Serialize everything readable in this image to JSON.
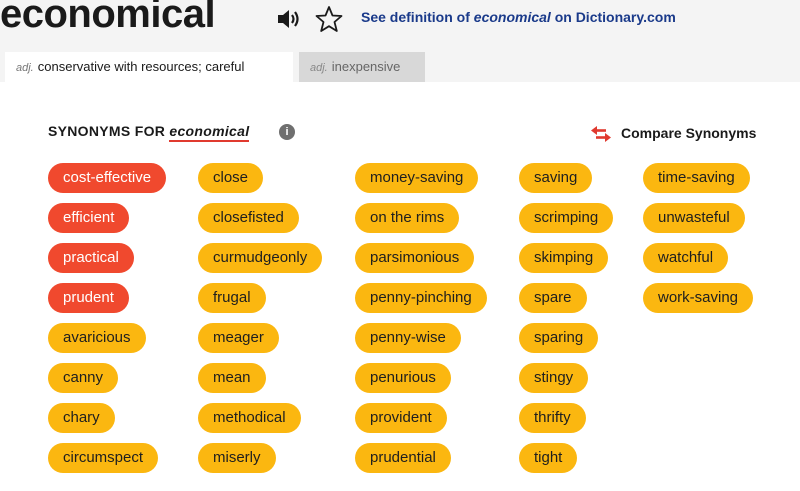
{
  "header": {
    "word": "economical",
    "dictionary_link": {
      "prefix": "See definition of ",
      "word": "economical",
      "suffix": " on Dictionary.com"
    }
  },
  "tabs": [
    {
      "pos": "adj.",
      "label": "conservative with resources; careful",
      "active": true
    },
    {
      "pos": "adj.",
      "label": "inexpensive",
      "active": false
    }
  ],
  "synonyms_section": {
    "heading_prefix": "SYNONYMS FOR ",
    "heading_word": "economical",
    "info_glyph": "i",
    "compare_label": "Compare Synonyms"
  },
  "colors": {
    "strong_match": "#f0492e",
    "match": "#fbb710",
    "heading_underline": "#e03a2f",
    "link": "#1a3a8a"
  },
  "icons": [
    "speaker-icon",
    "star-icon",
    "info-icon",
    "compare-arrows-icon"
  ],
  "synonym_columns": [
    [
      {
        "word": "cost-effective",
        "strength": "strong"
      },
      {
        "word": "efficient",
        "strength": "strong"
      },
      {
        "word": "practical",
        "strength": "strong"
      },
      {
        "word": "prudent",
        "strength": "strong"
      },
      {
        "word": "avaricious",
        "strength": "normal"
      },
      {
        "word": "canny",
        "strength": "normal"
      },
      {
        "word": "chary",
        "strength": "normal"
      },
      {
        "word": "circumspect",
        "strength": "normal"
      }
    ],
    [
      {
        "word": "close",
        "strength": "normal"
      },
      {
        "word": "closefisted",
        "strength": "normal"
      },
      {
        "word": "curmudgeonly",
        "strength": "normal"
      },
      {
        "word": "frugal",
        "strength": "normal"
      },
      {
        "word": "meager",
        "strength": "normal"
      },
      {
        "word": "mean",
        "strength": "normal"
      },
      {
        "word": "methodical",
        "strength": "normal"
      },
      {
        "word": "miserly",
        "strength": "normal"
      }
    ],
    [
      {
        "word": "money-saving",
        "strength": "normal"
      },
      {
        "word": "on the rims",
        "strength": "normal"
      },
      {
        "word": "parsimonious",
        "strength": "normal"
      },
      {
        "word": "penny-pinching",
        "strength": "normal"
      },
      {
        "word": "penny-wise",
        "strength": "normal"
      },
      {
        "word": "penurious",
        "strength": "normal"
      },
      {
        "word": "provident",
        "strength": "normal"
      },
      {
        "word": "prudential",
        "strength": "normal"
      }
    ],
    [
      {
        "word": "saving",
        "strength": "normal"
      },
      {
        "word": "scrimping",
        "strength": "normal"
      },
      {
        "word": "skimping",
        "strength": "normal"
      },
      {
        "word": "spare",
        "strength": "normal"
      },
      {
        "word": "sparing",
        "strength": "normal"
      },
      {
        "word": "stingy",
        "strength": "normal"
      },
      {
        "word": "thrifty",
        "strength": "normal"
      },
      {
        "word": "tight",
        "strength": "normal"
      }
    ],
    [
      {
        "word": "time-saving",
        "strength": "normal"
      },
      {
        "word": "unwasteful",
        "strength": "normal"
      },
      {
        "word": "watchful",
        "strength": "normal"
      },
      {
        "word": "work-saving",
        "strength": "normal"
      }
    ]
  ]
}
